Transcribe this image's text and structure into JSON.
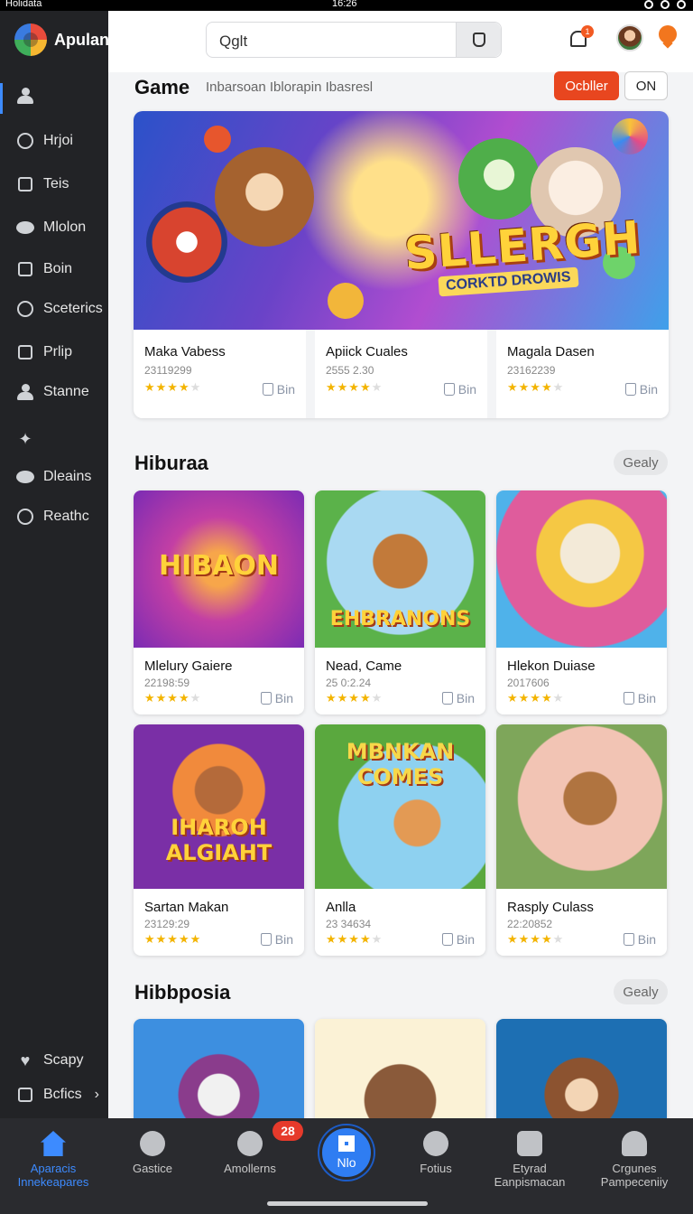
{
  "status": {
    "left": "Holidata",
    "time": "16:26"
  },
  "app": {
    "name": "Apulan"
  },
  "sidebar": {
    "items": [
      {
        "label": "",
        "icon": "people-icon"
      },
      {
        "label": "Hrjoi",
        "icon": "search-icon"
      },
      {
        "label": "Teis",
        "icon": "tile-icon"
      },
      {
        "label": "Mlolon",
        "icon": "chat-icon"
      },
      {
        "label": "Boin",
        "icon": "box-icon"
      },
      {
        "label": "Sceterics",
        "icon": "bubble-icon"
      },
      {
        "label": "Prlip",
        "icon": "square-icon"
      },
      {
        "label": "Stanne",
        "icon": "user-icon"
      },
      {
        "label": "",
        "icon": "pin-icon"
      },
      {
        "label": "Dleains",
        "icon": "cloud-icon"
      },
      {
        "label": "Reathc",
        "icon": "circle-icon"
      }
    ],
    "footer": [
      {
        "label": "Scapy",
        "icon": "heart-icon"
      },
      {
        "label": "Bcfics",
        "icon": "panel-icon"
      }
    ]
  },
  "header": {
    "search_value": "Qglt",
    "notif_count": "1"
  },
  "sections": {
    "game": {
      "title": "Game",
      "subtitle": "Inbarsoan Iblorapin Ibasresl",
      "btn_primary": "Ocbller",
      "btn_secondary": "ON",
      "hero_title": "SLLERGH",
      "hero_sub": "CORKTD DROWIS",
      "cards": [
        {
          "title": "Maka Vabess",
          "meta": "23119299",
          "like": "Bin"
        },
        {
          "title": "Apiick Cuales",
          "meta": "2555 2.30",
          "like": "Bin"
        },
        {
          "title": "Magala Dasen",
          "meta": "23162239",
          "like": "Bin"
        }
      ]
    },
    "hiburaa": {
      "title": "Hiburaa",
      "pill": "Gealy",
      "cards": [
        {
          "title": "Mlelury Gaiere",
          "meta": "22198:59",
          "like": "Bin",
          "art": "HIBAON"
        },
        {
          "title": "Nead, Came",
          "meta": "25 0:2.24",
          "like": "Bin",
          "art": "EHBRANONS"
        },
        {
          "title": "Hlekon Duiase",
          "meta": "2017606",
          "like": "Bin",
          "art": ""
        },
        {
          "title": "Sartan Makan",
          "meta": "23129:29",
          "like": "Bin",
          "art": "IHAROH ALGIAHT"
        },
        {
          "title": "Anlla",
          "meta": "23 34634",
          "like": "Bin",
          "art": "MBNKAN COMES"
        },
        {
          "title": "Rasply Culass",
          "meta": "22:20852",
          "like": "Bin",
          "art": ""
        }
      ]
    },
    "hibbposia": {
      "title": "Hibbposia",
      "pill": "Gealy"
    }
  },
  "tabs": [
    {
      "label": "Aparacis Innekeapares"
    },
    {
      "label": "Gastice"
    },
    {
      "label": "Amollerns",
      "badge": "28"
    },
    {
      "label": "Nlo"
    },
    {
      "label": "Fotius"
    },
    {
      "label": "Etyrad Eanpismacan"
    },
    {
      "label": "Crgunes Pampeceniiy"
    }
  ],
  "colors": {
    "accent": "#3d8bff",
    "primary_button": "#e8461f",
    "star": "#f3b400"
  }
}
